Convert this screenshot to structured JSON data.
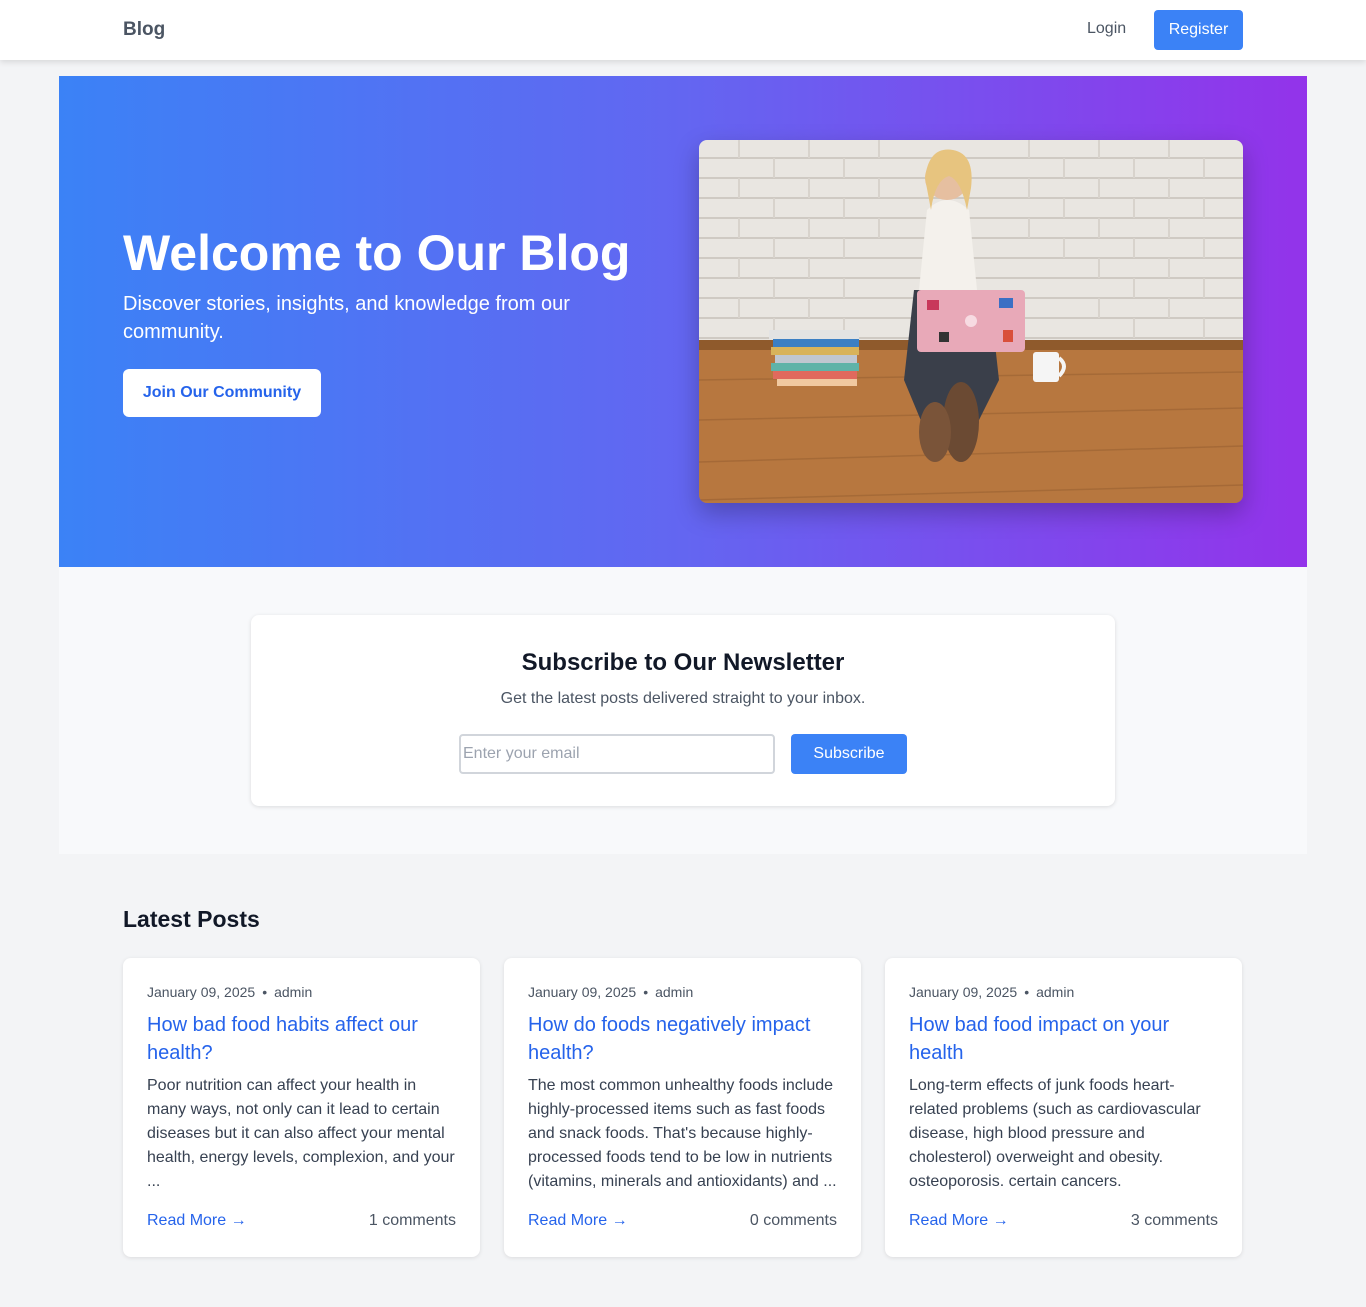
{
  "navbar": {
    "brand": "Blog",
    "login_label": "Login",
    "register_label": "Register"
  },
  "hero": {
    "title": "Welcome to Our Blog",
    "subtitle": "Discover stories, insights, and knowledge from our community.",
    "cta_label": "Join Our Community",
    "image": "photo-woman-laptop"
  },
  "newsletter": {
    "title": "Subscribe to Our Newsletter",
    "subtitle": "Get the latest posts delivered straight to your inbox.",
    "email_placeholder": "Enter your email",
    "email_value": "",
    "button_label": "Subscribe"
  },
  "latest": {
    "heading": "Latest Posts",
    "posts": [
      {
        "date": "January 09, 2025",
        "author": "admin",
        "title": "How bad food habits affect our health?",
        "excerpt": "Poor nutrition can affect your health in many ways, not only can it lead to certain diseases but it can also affect your mental health, energy levels, complexion, and your ...",
        "read_more": "Read More →",
        "comments": "1 comments"
      },
      {
        "date": "January 09, 2025",
        "author": "admin",
        "title": "How do foods negatively impact health?",
        "excerpt": "The most common unhealthy foods include highly-processed items such as fast foods and snack foods. That's because highly-processed foods tend to be low in nutrients (vitamins, minerals and antioxidants) and ...",
        "read_more": "Read More →",
        "comments": "0 comments"
      },
      {
        "date": "January 09, 2025",
        "author": "admin",
        "title": "How bad food impact on your health",
        "excerpt": "Long-term effects of junk foods heart-related problems (such as cardiovascular disease, high blood pressure and cholesterol) overweight and obesity. osteoporosis. certain cancers.",
        "read_more": "Read More →",
        "comments": "3 comments"
      }
    ]
  },
  "colors": {
    "primary": "#3b82f6",
    "link": "#2563eb",
    "gradient_start": "#3b82f6",
    "gradient_end": "#9333ea"
  }
}
